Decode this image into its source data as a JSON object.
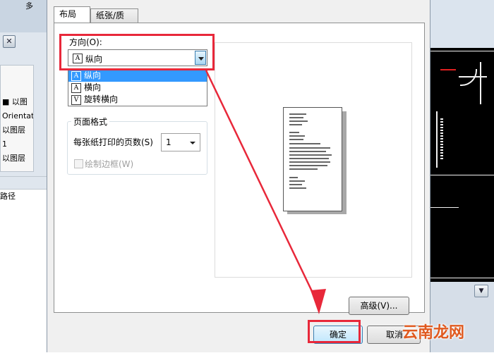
{
  "background_left": {
    "top_fragment": "多",
    "close_glyph": "✕",
    "rows": [
      "■ 以图",
      "Orientatio",
      "以图层",
      "1",
      "以图层"
    ],
    "lower_label": "路径"
  },
  "dialog": {
    "tabs": [
      "布局",
      "纸张/质量"
    ],
    "orientation": {
      "label": "方向(O):",
      "selected": "纵向",
      "options": [
        {
          "icon": "A",
          "label": "纵向"
        },
        {
          "icon": "A",
          "label": "横向"
        },
        {
          "icon": "V",
          "label": "旋转横向"
        }
      ]
    },
    "page_format": {
      "title": "页面格式",
      "pages_per_sheet_label": "每张纸打印的页数(S)",
      "pages_per_sheet_value": "1",
      "draw_border_label": "绘制边框(W)"
    },
    "advanced_button": "高级(V)...",
    "ok_button": "确定",
    "cancel_button": "取消"
  },
  "watermark": "云南龙网",
  "colors": {
    "highlight": "#e8283a",
    "selection": "#3399ff"
  }
}
